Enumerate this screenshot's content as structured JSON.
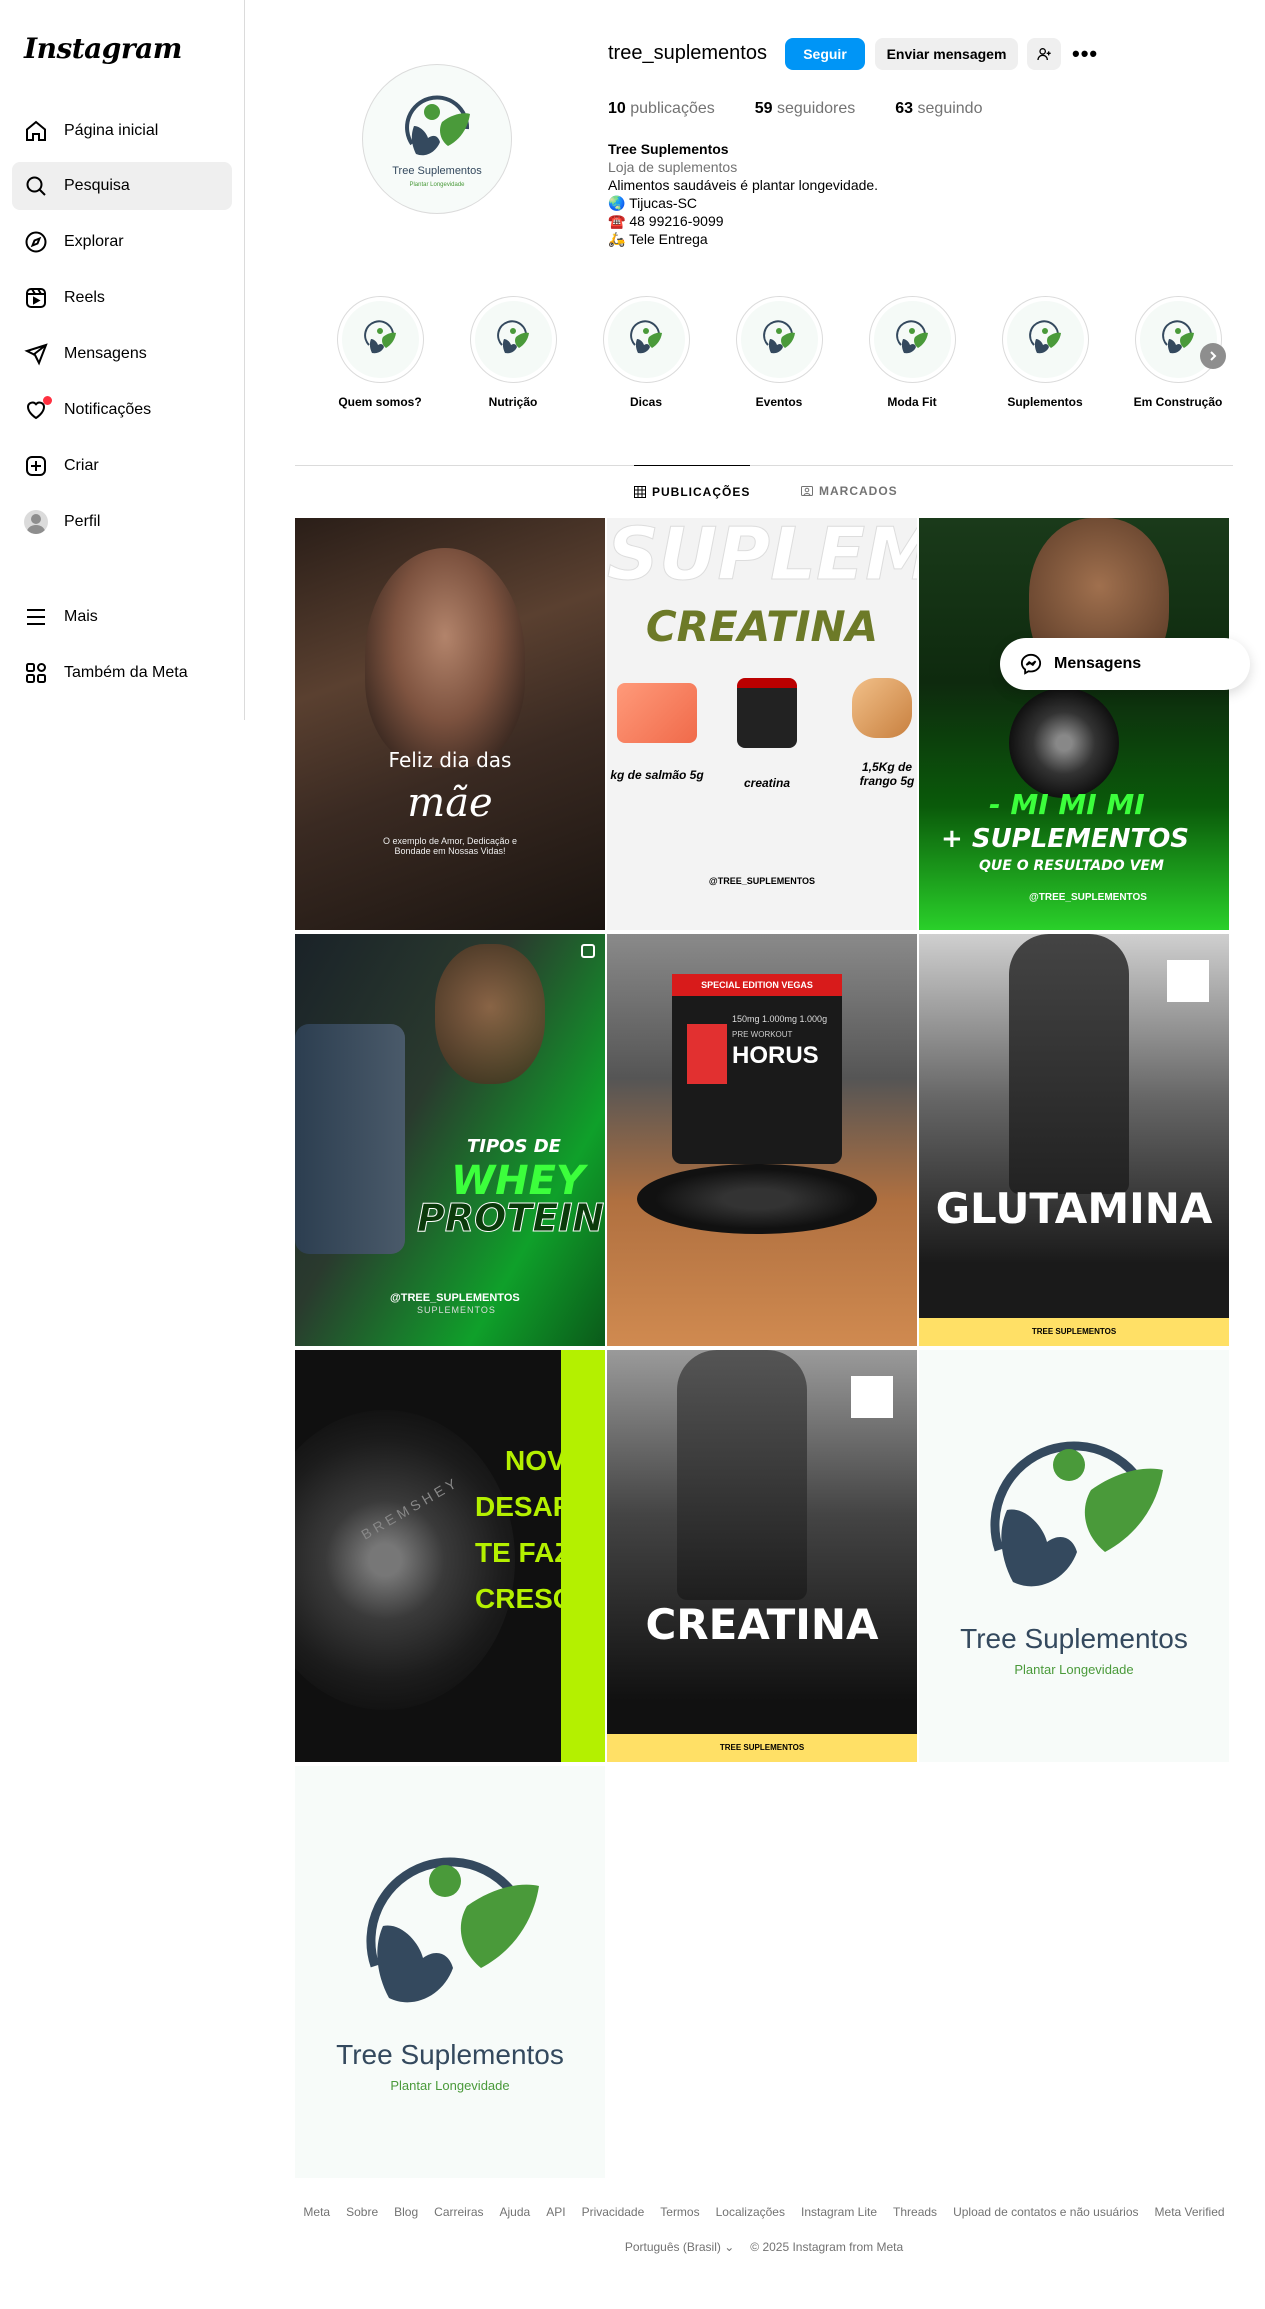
{
  "app": {
    "logo_text": "Instagram"
  },
  "sidebar": {
    "items": [
      {
        "label": "Página inicial",
        "icon": "home-icon"
      },
      {
        "label": "Pesquisa",
        "icon": "search-icon"
      },
      {
        "label": "Explorar",
        "icon": "compass-icon"
      },
      {
        "label": "Reels",
        "icon": "reels-icon"
      },
      {
        "label": "Mensagens",
        "icon": "send-icon"
      },
      {
        "label": "Notificações",
        "icon": "heart-icon"
      },
      {
        "label": "Criar",
        "icon": "plus-square-icon"
      },
      {
        "label": "Perfil",
        "icon": "avatar"
      },
      {
        "label": "Mais",
        "icon": "menu-icon"
      },
      {
        "label": "Também da Meta",
        "icon": "meta-apps-icon"
      }
    ]
  },
  "profile": {
    "username": "tree_suplementos",
    "follow_label": "Seguir",
    "message_label": "Enviar mensagem",
    "more_label": "•••",
    "stats": {
      "posts_count": "10",
      "posts_label": "publicações",
      "followers_count": "59",
      "followers_label": "seguidores",
      "following_count": "63",
      "following_label": "seguindo"
    },
    "bio": {
      "name": "Tree Suplementos",
      "category": "Loja de suplementos",
      "line1": "Alimentos saudáveis é plantar longevidade.",
      "line2_emoji": "🌏",
      "line2": "Tijucas-SC",
      "line3_emoji": "☎️",
      "line3": "48 99216-9099",
      "line4_emoji": "🛵",
      "line4": "Tele Entrega"
    },
    "logo_brand": "Tree Suplementos",
    "logo_tagline": "Plantar Longevidade"
  },
  "highlights": [
    {
      "label": "Quem somos?"
    },
    {
      "label": "Nutrição"
    },
    {
      "label": "Dicas"
    },
    {
      "label": "Eventos"
    },
    {
      "label": "Moda Fit"
    },
    {
      "label": "Suplementos"
    },
    {
      "label": "Em Construção"
    }
  ],
  "tabs": {
    "posts": "PUBLICAÇÕES",
    "tagged": "MARCADOS"
  },
  "posts": {
    "p1": {
      "line1": "Feliz dia das",
      "line2": "mãe",
      "line3": "O exemplo de Amor, Dedicação e Bondade em Nossas Vidas!"
    },
    "p2": {
      "title": "CREATINA",
      "bg_text": "SUPLEM",
      "item1": "kg de salmão 5g",
      "item2": "creatina",
      "item3": "1,5Kg de frango 5g",
      "handle": "@TREE_SUPLEMENTOS"
    },
    "p3": {
      "line1": "- MI MI MI",
      "line2": "+ SUPLEMENTOS",
      "line3": "QUE O RESULTADO VEM",
      "handle": "@TREE_SUPLEMENTOS"
    },
    "p4": {
      "line1": "TIPOS DE",
      "line2": "WHEY",
      "line3": "PROTEIN",
      "handle": "@TREE_SUPLEMENTOS",
      "sub": "SUPLEMENTOS"
    },
    "p5": {
      "band": "SPECIAL EDITION VEGAS",
      "brand": "HORUS",
      "sub": "PRE WORKOUT",
      "sizes": "150mg 1.000mg 1.000g"
    },
    "p6": {
      "title": "GLUTAMINA",
      "footer": "TREE SUPLEMENTOS"
    },
    "p7": {
      "line1": "NOVOS",
      "line2": "DESAFIOS",
      "line3": "TE FAZEM",
      "line4": "CRESCER",
      "plate": "BREMSHEY"
    },
    "p8": {
      "title": "CREATINA",
      "footer": "TREE SUPLEMENTOS"
    },
    "p9": {
      "brand": "Tree Suplementos",
      "tagline": "Plantar Longevidade"
    },
    "p10": {
      "brand": "Tree Suplementos",
      "tagline": "Plantar Longevidade"
    }
  },
  "float_messages": {
    "label": "Mensagens"
  },
  "footer": {
    "links": [
      "Meta",
      "Sobre",
      "Blog",
      "Carreiras",
      "Ajuda",
      "API",
      "Privacidade",
      "Termos",
      "Localizações",
      "Instagram Lite",
      "Threads",
      "Upload de contatos e não usuários",
      "Meta Verified"
    ],
    "language": "Português (Brasil)",
    "copyright": "© 2025 Instagram from Meta"
  },
  "colors": {
    "accent": "#0095f6",
    "brand_green": "#4a9a3a",
    "brand_navy": "#34495e",
    "lime": "#b4f000",
    "yellow": "#ffe066"
  }
}
